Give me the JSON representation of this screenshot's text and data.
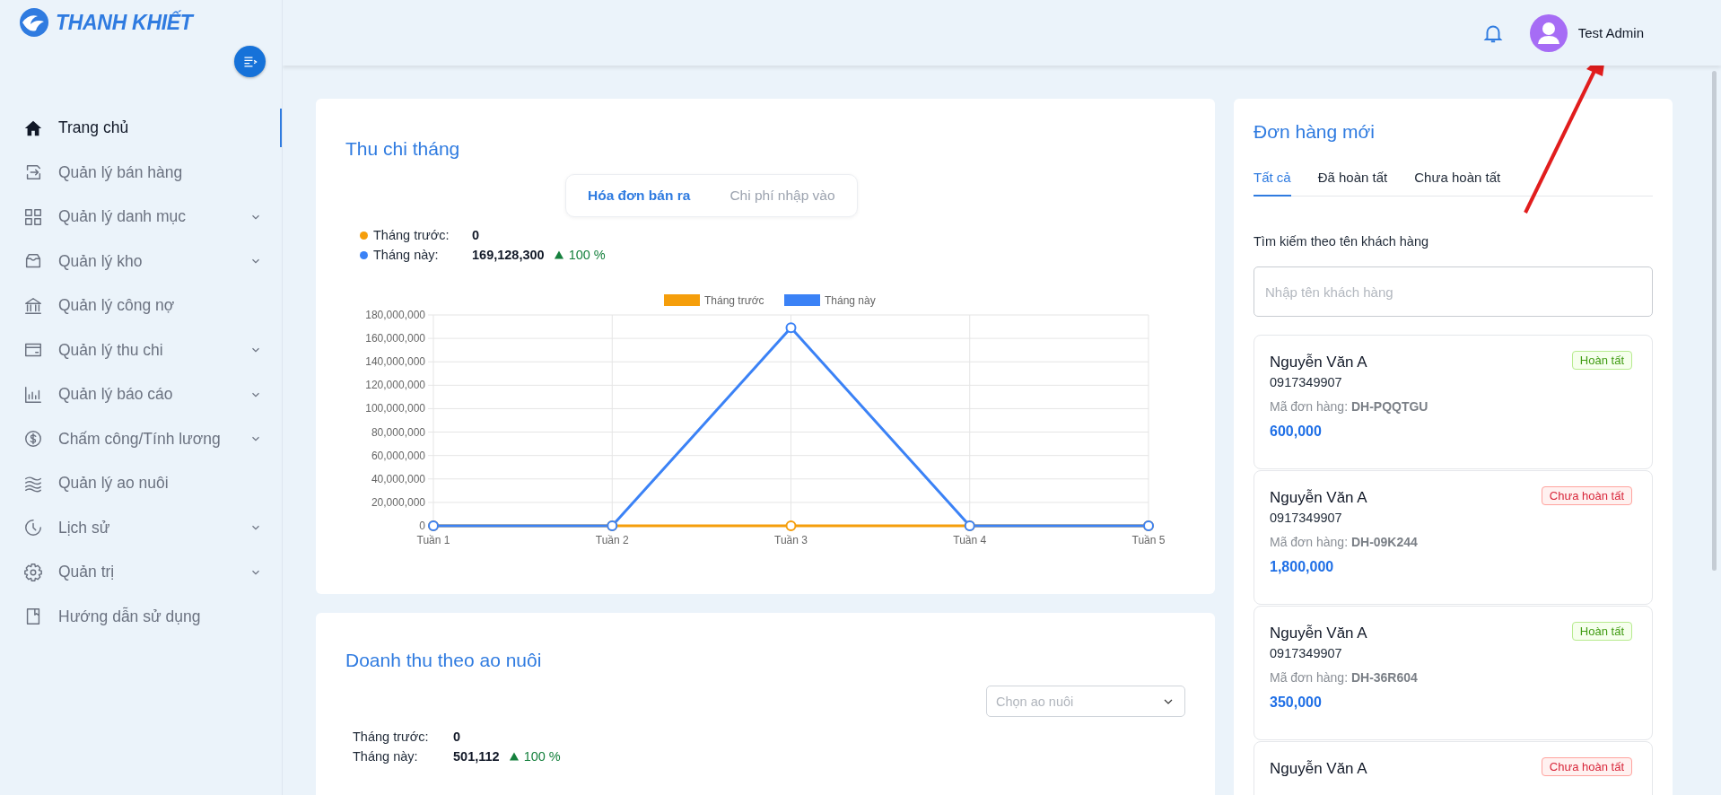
{
  "brand": {
    "name": "THANH KHIẾT"
  },
  "sidebar": {
    "items": [
      {
        "label": "Trang chủ",
        "selected": true,
        "expandable": false
      },
      {
        "label": "Quản lý bán hàng",
        "selected": false,
        "expandable": false
      },
      {
        "label": "Quản lý danh mục",
        "selected": false,
        "expandable": true
      },
      {
        "label": "Quản lý kho",
        "selected": false,
        "expandable": true
      },
      {
        "label": "Quản lý công nợ",
        "selected": false,
        "expandable": false
      },
      {
        "label": "Quản lý thu chi",
        "selected": false,
        "expandable": true
      },
      {
        "label": "Quản lý báo cáo",
        "selected": false,
        "expandable": true
      },
      {
        "label": "Chấm công/Tính lương",
        "selected": false,
        "expandable": true
      },
      {
        "label": "Quản lý ao nuôi",
        "selected": false,
        "expandable": false
      },
      {
        "label": "Lịch sử",
        "selected": false,
        "expandable": true
      },
      {
        "label": "Quản trị",
        "selected": false,
        "expandable": true
      },
      {
        "label": "Hướng dẫn sử dụng",
        "selected": false,
        "expandable": false
      }
    ]
  },
  "header": {
    "user": "Test Admin"
  },
  "monthly": {
    "title": "Thu chi tháng",
    "tabs": [
      {
        "label": "Hóa đơn bán ra",
        "selected": true
      },
      {
        "label": "Chi phí nhập vào",
        "selected": false
      }
    ],
    "summary": [
      {
        "label": "Tháng trước:",
        "value": "0",
        "color": "#f59e0b"
      },
      {
        "label": "Tháng này:",
        "value": "169,128,300",
        "change": "100 %",
        "color": "#3b82f6"
      }
    ],
    "chart_data": {
      "type": "line",
      "grid": true,
      "legend": true,
      "categories": [
        "Tuần 1",
        "Tuần 2",
        "Tuần 3",
        "Tuần 4",
        "Tuần 5"
      ],
      "series": [
        {
          "name": "Tháng trước",
          "color": "#f59e0b",
          "marker": "circle",
          "values": [
            0,
            0,
            0,
            0,
            0
          ]
        },
        {
          "name": "Tháng này",
          "color": "#3b82f6",
          "marker": "circle",
          "values": [
            0,
            0,
            169000000,
            0,
            0
          ]
        }
      ],
      "ylim": [
        0,
        180000000
      ],
      "yticks": [
        {
          "value": 0,
          "label": "0"
        },
        {
          "value": 20000000,
          "label": "20,000,000"
        },
        {
          "value": 40000000,
          "label": "40,000,000"
        },
        {
          "value": 60000000,
          "label": "60,000,000"
        },
        {
          "value": 80000000,
          "label": "80,000,000"
        },
        {
          "value": 100000000,
          "label": "100,000,000"
        },
        {
          "value": 120000000,
          "label": "120,000,000"
        },
        {
          "value": 140000000,
          "label": "140,000,000"
        },
        {
          "value": 160000000,
          "label": "160,000,000"
        },
        {
          "value": 180000000,
          "label": "180,000,000"
        }
      ]
    }
  },
  "pond": {
    "title": "Doanh thu theo ao nuôi",
    "select": {
      "placeholder": "Chọn ao nuôi"
    },
    "summary": [
      {
        "label": "Tháng trước:",
        "value": "0"
      },
      {
        "label": "Tháng này:",
        "value": "501,112",
        "change": "100 %"
      }
    ]
  },
  "orders": {
    "title": "Đơn hàng mới",
    "tabs": [
      {
        "label": "Tất cả",
        "selected": true
      },
      {
        "label": "Đã hoàn tất",
        "selected": false
      },
      {
        "label": "Chưa hoàn tất",
        "selected": false
      }
    ],
    "search": {
      "label": "Tìm kiếm theo tên khách hàng",
      "placeholder": "Nhập tên khách hàng"
    },
    "items": [
      {
        "name": "Nguyễn Văn A",
        "phone": "0917349907",
        "code_label": "Mã đơn hàng:",
        "code": "DH-PQQTGU",
        "amount": "600,000",
        "status": "Hoàn tất",
        "completed": true
      },
      {
        "name": "Nguyễn Văn A",
        "phone": "0917349907",
        "code_label": "Mã đơn hàng:",
        "code": "DH-09K244",
        "amount": "1,800,000",
        "status": "Chưa hoàn tất",
        "completed": false
      },
      {
        "name": "Nguyễn Văn A",
        "phone": "0917349907",
        "code_label": "Mã đơn hàng:",
        "code": "DH-36R604",
        "amount": "350,000",
        "status": "Hoàn tất",
        "completed": true
      },
      {
        "name": "Nguyễn Văn A",
        "status": "Chưa hoàn tất",
        "completed": false
      }
    ]
  }
}
